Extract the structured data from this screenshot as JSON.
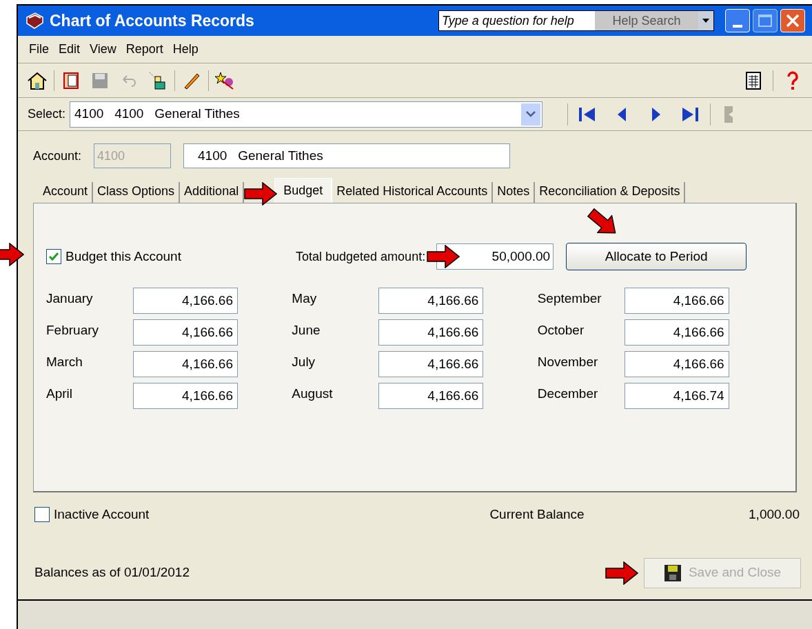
{
  "window": {
    "title": "Chart of Accounts Records"
  },
  "help": {
    "placeholder": "Type a question for help",
    "button": "Help Search"
  },
  "menu": [
    "File",
    "Edit",
    "View",
    "Report",
    "Help"
  ],
  "select": {
    "label": "Select:",
    "value": "4100   4100   General Tithes"
  },
  "account": {
    "label": "Account:",
    "number": "4100",
    "number_disabled": true,
    "name": "4100   General Tithes"
  },
  "tabs": [
    {
      "label": "Account",
      "selected": false
    },
    {
      "label": "Class Options",
      "selected": false
    },
    {
      "label": "Additional",
      "selected": false
    },
    {
      "label": "Budget",
      "selected": true
    },
    {
      "label": "Related Historical Accounts",
      "selected": false
    },
    {
      "label": "Notes",
      "selected": false
    },
    {
      "label": "Reconciliation & Deposits",
      "selected": false
    }
  ],
  "budget": {
    "checkbox": {
      "label": "Budget this Account",
      "checked": true
    },
    "total": {
      "label": "Total budgeted amount:",
      "value": "50,000.00"
    },
    "allocate_button": "Allocate to Period",
    "months": [
      {
        "name": "January",
        "value": "4,166.66"
      },
      {
        "name": "February",
        "value": "4,166.66"
      },
      {
        "name": "March",
        "value": "4,166.66"
      },
      {
        "name": "April",
        "value": "4,166.66"
      },
      {
        "name": "May",
        "value": "4,166.66"
      },
      {
        "name": "June",
        "value": "4,166.66"
      },
      {
        "name": "July",
        "value": "4,166.66"
      },
      {
        "name": "August",
        "value": "4,166.66"
      },
      {
        "name": "September",
        "value": "4,166.66"
      },
      {
        "name": "October",
        "value": "4,166.66"
      },
      {
        "name": "November",
        "value": "4,166.66"
      },
      {
        "name": "December",
        "value": "4,166.74"
      }
    ]
  },
  "inactive": {
    "label": "Inactive Account",
    "checked": false
  },
  "current_balance": {
    "label": "Current Balance",
    "value": "1,000.00"
  },
  "balances_note": "Balances as of 01/01/2012",
  "save_button": {
    "label": "Save and Close",
    "disabled": true
  }
}
